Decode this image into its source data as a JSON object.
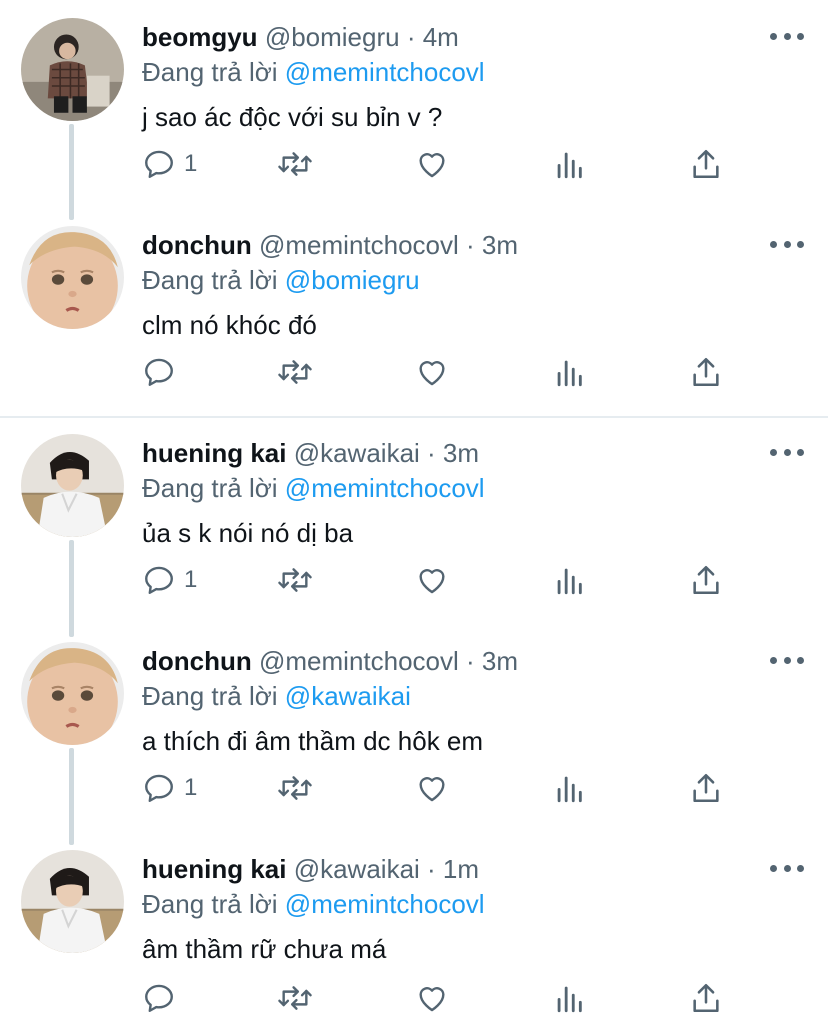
{
  "colors": {
    "text": "#0f1419",
    "secondary": "#536471",
    "mention": "#1d9bf0",
    "thread_line": "#cfd9de",
    "divider": "#e6ecf0"
  },
  "icons": {
    "reply": "reply-icon",
    "retweet": "retweet-icon",
    "like": "heart-icon",
    "stats": "stats-icon",
    "share": "share-icon",
    "more": "more-icon"
  },
  "tweets": [
    {
      "name": "beomgyu",
      "handle": "@bomiegru",
      "time": "· 4m",
      "reply_prefix": "Đang trả lời",
      "reply_to": "@memintchocovl",
      "text": "j sao ác độc với su bỉn v ?",
      "reply_count": "1"
    },
    {
      "name": "donchun",
      "handle": "@memintchocovl",
      "time": "· 3m",
      "reply_prefix": "Đang trả lời",
      "reply_to": "@bomiegru",
      "text": "clm nó khóc đó",
      "reply_count": ""
    },
    {
      "name": "huening kai",
      "handle": "@kawaikai",
      "time": "· 3m",
      "reply_prefix": "Đang trả lời",
      "reply_to": "@memintchocovl",
      "text": "ủa s k nói nó dị ba",
      "reply_count": "1"
    },
    {
      "name": "donchun",
      "handle": "@memintchocovl",
      "time": "· 3m",
      "reply_prefix": "Đang trả lời",
      "reply_to": "@kawaikai",
      "text": "a thích đi âm thầm dc hôk em",
      "reply_count": "1"
    },
    {
      "name": "huening kai",
      "handle": "@kawaikai",
      "time": "· 1m",
      "reply_prefix": "Đang trả lời",
      "reply_to": "@memintchocovl",
      "text": "âm thầm rữ chưa má",
      "reply_count": ""
    }
  ]
}
